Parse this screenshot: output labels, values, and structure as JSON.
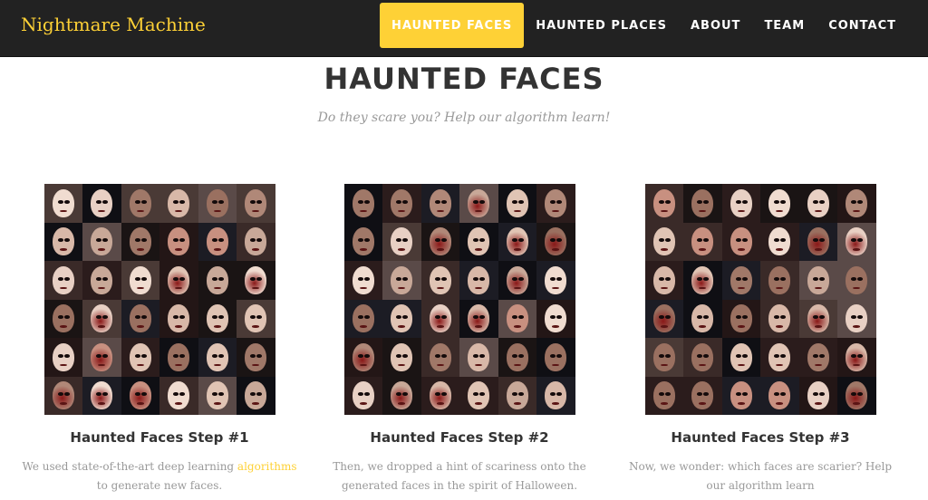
{
  "brand": "Nightmare Machine",
  "nav": [
    {
      "label": "HAUNTED FACES",
      "active": true
    },
    {
      "label": "HAUNTED PLACES",
      "active": false
    },
    {
      "label": "ABOUT",
      "active": false
    },
    {
      "label": "TEAM",
      "active": false
    },
    {
      "label": "CONTACT",
      "active": false
    }
  ],
  "page_title": "HAUNTED FACES",
  "subtitle": "Do they scare you? Help our algorithm learn!",
  "steps": [
    {
      "title": "Haunted Faces Step #1",
      "text_before": "We used state-of-the-art deep learning ",
      "link": "algorithms",
      "text_after": " to generate new faces."
    },
    {
      "title": "Haunted Faces Step #2",
      "text_before": "Then, we dropped a hint of scariness onto the generated faces in the spirit of Halloween.",
      "link": "",
      "text_after": ""
    },
    {
      "title": "Haunted Faces Step #3",
      "text_before": "Now, we wonder: which faces are scarier? Help our algorithm learn",
      "link": "",
      "text_after": ""
    }
  ],
  "colors": {
    "accent": "#fed136",
    "navbar": "#222222",
    "heading": "#333333",
    "muted": "#999999"
  },
  "images": [
    "face-collage-step-1",
    "face-collage-step-2",
    "face-collage-step-3"
  ]
}
